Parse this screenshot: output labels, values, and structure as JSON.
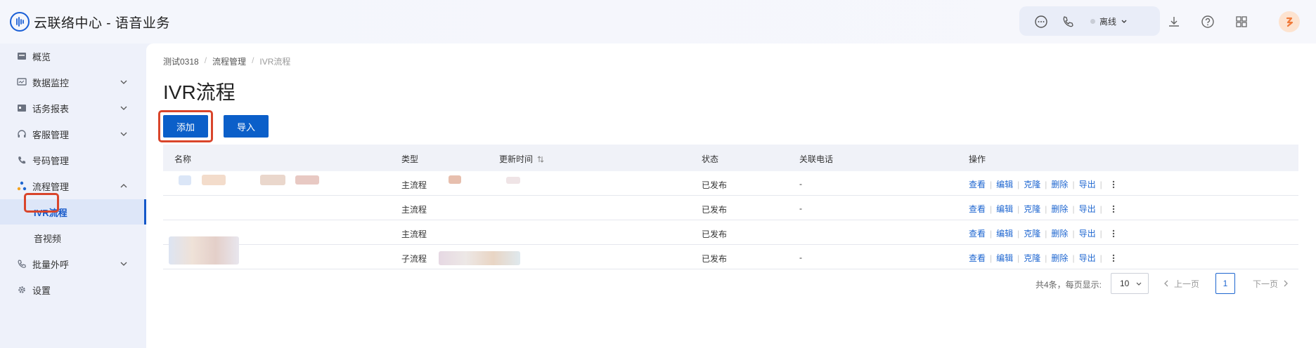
{
  "header": {
    "app_title": "云联络中心 - 语音业务",
    "status_label": "离线",
    "icons": [
      "chat-icon",
      "phone-icon",
      "download-icon",
      "help-icon",
      "grid-icon"
    ]
  },
  "sidebar": {
    "items": [
      {
        "label": "概览",
        "icon": "dashboard-icon"
      },
      {
        "label": "数据监控",
        "icon": "monitor-icon"
      },
      {
        "label": "话务报表",
        "icon": "report-icon"
      },
      {
        "label": "客服管理",
        "icon": "headset-icon"
      },
      {
        "label": "号码管理",
        "icon": "phone-icon"
      },
      {
        "label": "流程管理",
        "icon": "flow-icon"
      },
      {
        "label": "IVR流程"
      },
      {
        "label": "音视频"
      },
      {
        "label": "批量外呼",
        "icon": "outbound-icon"
      },
      {
        "label": "设置",
        "icon": "gear-icon"
      }
    ]
  },
  "breadcrumb": {
    "items": [
      "测试0318",
      "流程管理",
      "IVR流程"
    ]
  },
  "page": {
    "title": "IVR流程"
  },
  "buttons": {
    "add": "添加",
    "import": "导入"
  },
  "table": {
    "columns": [
      "名称",
      "类型",
      "更新时间",
      "状态",
      "关联电话",
      "操作"
    ],
    "rows": [
      {
        "type": "主流程",
        "status": "已发布",
        "phone": "-"
      },
      {
        "type": "主流程",
        "status": "已发布",
        "phone": "-"
      },
      {
        "type": "主流程",
        "status": "已发布",
        "phone": ""
      },
      {
        "type": "子流程",
        "status": "已发布",
        "phone": "-"
      }
    ],
    "actions": [
      "查看",
      "编辑",
      "克隆",
      "删除",
      "导出"
    ]
  },
  "pagination": {
    "summary": "共4条，每页显示:",
    "page_size": "10",
    "prev": "上一页",
    "current": "1",
    "next": "下一页"
  },
  "colors": {
    "accent": "#0b5fc9",
    "highlight": "#d9452b",
    "link": "#1e66d0"
  }
}
